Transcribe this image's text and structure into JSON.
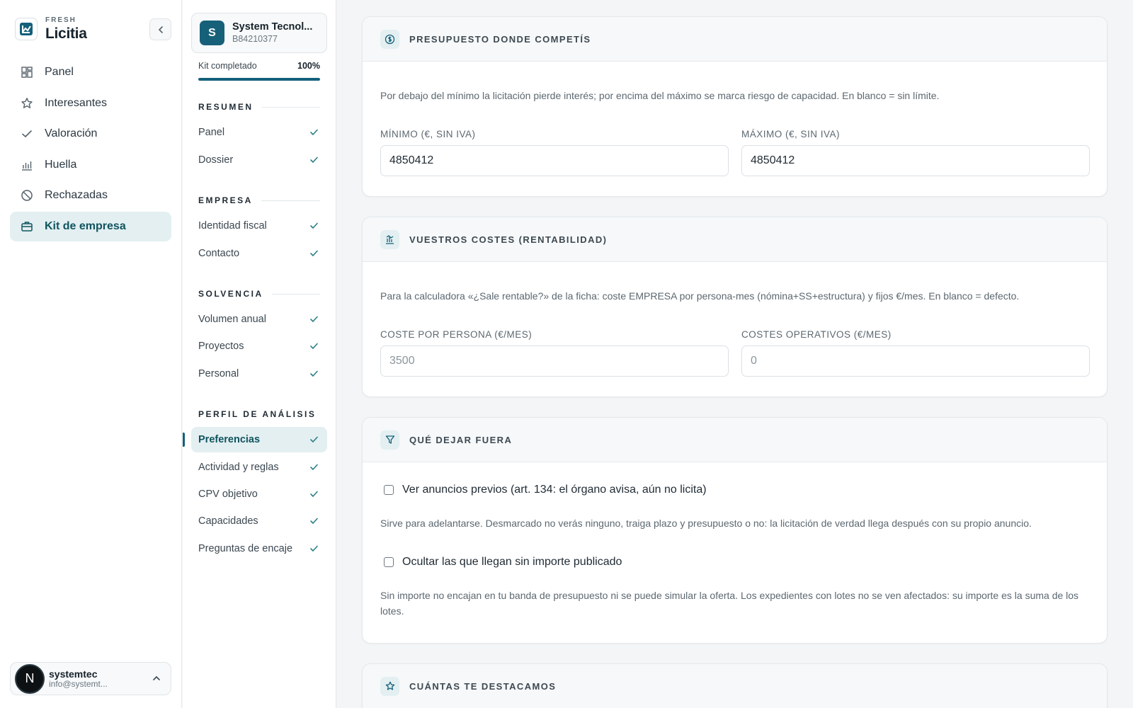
{
  "brand": {
    "kicker": "FRESH",
    "name": "Licitia"
  },
  "nav": {
    "items": [
      {
        "label": "Panel",
        "icon": "layout-grid-icon"
      },
      {
        "label": "Interesantes",
        "icon": "star-icon"
      },
      {
        "label": "Valoración",
        "icon": "check-icon"
      },
      {
        "label": "Huella",
        "icon": "bar-chart-icon"
      },
      {
        "label": "Rechazadas",
        "icon": "ban-icon"
      },
      {
        "label": "Kit de empresa",
        "icon": "briefcase-icon",
        "active": true
      }
    ]
  },
  "user": {
    "initial": "N",
    "name": "systemtec",
    "email": "info@systemt..."
  },
  "company": {
    "initial": "S",
    "name": "System Tecnol...",
    "cif": "B84210377"
  },
  "kit": {
    "label": "Kit completado",
    "percent_label": "100%",
    "percent": 100
  },
  "subnav": {
    "sections": [
      {
        "title": "RESUMEN",
        "items": [
          "Panel",
          "Dossier"
        ]
      },
      {
        "title": "EMPRESA",
        "items": [
          "Identidad fiscal",
          "Contacto"
        ]
      },
      {
        "title": "SOLVENCIA",
        "items": [
          "Volumen anual",
          "Proyectos",
          "Personal"
        ]
      },
      {
        "title": "PERFIL DE ANÁLISIS",
        "items": [
          "Preferencias",
          "Actividad y reglas",
          "CPV objetivo",
          "Capacidades",
          "Preguntas de encaje"
        ]
      }
    ],
    "active_item": "Preferencias"
  },
  "budget": {
    "title": "PRESUPUESTO DONDE COMPETÍS",
    "description": "Por debajo del mínimo la licitación pierde interés; por encima del máximo se marca riesgo de capacidad. En blanco = sin límite.",
    "min_label": "MÍNIMO (€, SIN IVA)",
    "min_value": "4850412",
    "max_label": "MÁXIMO (€, SIN IVA)",
    "max_value": "4850412"
  },
  "costs": {
    "title": "VUESTROS COSTES (RENTABILIDAD)",
    "description": "Para la calculadora «¿Sale rentable?» de la ficha: coste EMPRESA por persona-mes (nómina+SS+estructura) y fijos €/mes. En blanco = defecto.",
    "person_label": "COSTE POR PERSONA (€/MES)",
    "person_placeholder": "3500",
    "ops_label": "COSTES OPERATIVOS (€/MES)",
    "ops_placeholder": "0"
  },
  "exclude": {
    "title": "QUÉ DEJAR FUERA",
    "option1_label": "Ver anuncios previos (art. 134: el órgano avisa, aún no licita)",
    "option1_help": "Sirve para adelantarse. Desmarcado no verás ninguno, traiga plazo y presupuesto o no: la licitación de verdad llega después con su propio anuncio.",
    "option2_label": "Ocultar las que llegan sin importe publicado",
    "option2_help": "Sin importe no encajan en tu banda de presupuesto ni se puede simular la oferta. Los expedientes con lotes no se ven afectados: su importe es la suma de los lotes."
  },
  "highlight": {
    "title": "CUÁNTAS TE DESTACAMOS"
  },
  "colors": {
    "accent": "#14607a",
    "active_bg": "#e3eff1",
    "check": "#2a7f86"
  }
}
